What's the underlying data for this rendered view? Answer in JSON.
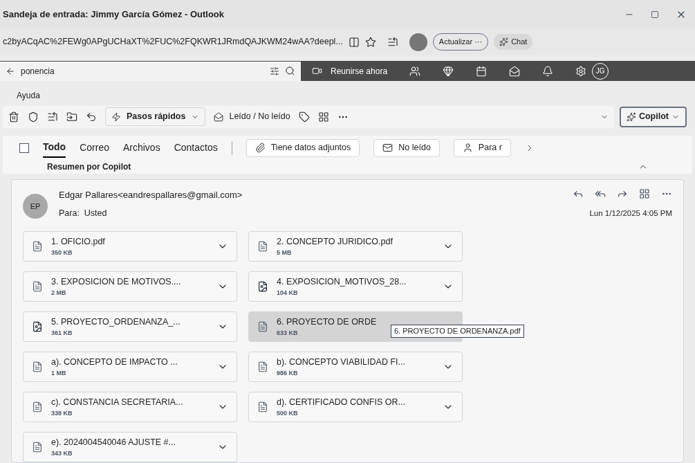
{
  "window": {
    "title": "Sandeja de entrada: Jimmy García Gómez - Outlook"
  },
  "address_bar": {
    "url": "c2byACqAC%2FEWg0APgUCHaXT%2FUC%2FQKWR1JRmdQAJKWM24wAA?deepl...",
    "update_button": "Actualizar ···",
    "chat_button": "Chat"
  },
  "top_bar": {
    "search_value": "ponencia",
    "meet_now": "Reunirse ahora",
    "avatar": "JG"
  },
  "menu": {
    "label": "Ayuda"
  },
  "toolbar": {
    "quick_steps": "Pasos rápidos",
    "read_unread": "Leído / No leído",
    "copilot": "Copilot"
  },
  "filters": {
    "select_all_checked": false,
    "tabs": [
      {
        "label": "Todo",
        "selected": true
      },
      {
        "label": "Correo",
        "selected": false
      },
      {
        "label": "Archivos",
        "selected": false
      },
      {
        "label": "Contactos",
        "selected": false
      }
    ],
    "chips": [
      {
        "label": "Tiene datos adjuntos",
        "kind": "attachment"
      },
      {
        "label": "No leído",
        "kind": "unread"
      },
      {
        "label": "Para r",
        "kind": "person"
      }
    ]
  },
  "copilot_summary": "Resumen por Copilot",
  "message": {
    "avatar": "EP",
    "sender": "Edgar Pallares<eandrespallares@gmail.com>",
    "to": "Para:  Usted",
    "date": "Lun 1/12/2025 4:05 PM",
    "attachments": [
      {
        "name": "1. OFICIO.pdf",
        "size": "350 KB",
        "kind": "pdf",
        "highlighted": false
      },
      {
        "name": "2. CONCEPTO JURIDICO.pdf",
        "size": "5 MB",
        "kind": "pdf",
        "highlighted": false
      },
      {
        "name": "3. EXPOSICION DE MOTIVOS....",
        "size": "2 MB",
        "kind": "pdf",
        "highlighted": false
      },
      {
        "name": "4. EXPOSICION_MOTIVOS_28...",
        "size": "104 KB",
        "kind": "doc",
        "highlighted": false
      },
      {
        "name": "5. PROYECTO_ORDENANZA_...",
        "size": "361 KB",
        "kind": "doc",
        "highlighted": false
      },
      {
        "name": "6. PROYECTO DE ORDE",
        "size": "633 KB",
        "kind": "pdf",
        "highlighted": true,
        "tooltip": "6. PROYECTO DE ORDENANZA.pdf"
      },
      {
        "name": "a). CONCEPTO DE IMPACTO ...",
        "size": "1 MB",
        "kind": "pdf",
        "highlighted": false
      },
      {
        "name": "b). CONCEPTO VIABILIDAD FI...",
        "size": "986 KB",
        "kind": "pdf",
        "highlighted": false
      },
      {
        "name": "c). CONSTANCIA SECRETARIA...",
        "size": "338 KB",
        "kind": "pdf",
        "highlighted": false
      },
      {
        "name": "d). CERTIFICADO CONFIS OR...",
        "size": "500 KB",
        "kind": "pdf",
        "highlighted": false
      },
      {
        "name": "e). 2024004540046 AJUSTE #...",
        "size": "343 KB",
        "kind": "pdf",
        "highlighted": false
      }
    ]
  }
}
